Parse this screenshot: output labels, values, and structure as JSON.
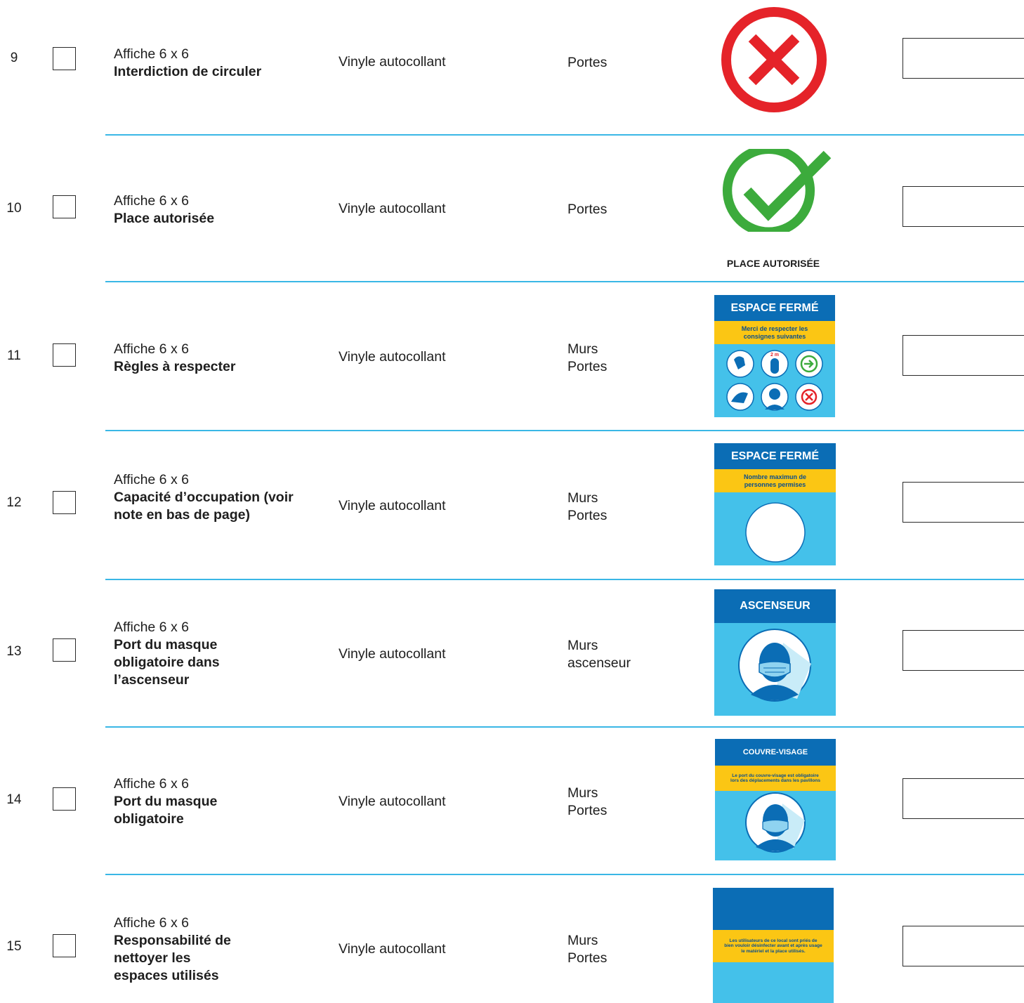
{
  "rows": [
    {
      "num": "9",
      "format": "Affiche 6 x 6",
      "name": "Interdiction de circuler",
      "material": "Vinyle autocollant",
      "locations": [
        "Portes"
      ],
      "qty": ""
    },
    {
      "num": "10",
      "format": "Affiche 6 x 6",
      "name": "Place autorisée",
      "material": "Vinyle autocollant",
      "locations": [
        "Portes"
      ],
      "qty": ""
    },
    {
      "num": "11",
      "format": "Affiche 6 x 6",
      "name": "Règles à respecter",
      "material": "Vinyle autocollant",
      "locations": [
        "Murs",
        "Portes"
      ],
      "qty": ""
    },
    {
      "num": "12",
      "format": "Affiche 6 x 6",
      "name": "Capacité d’occupation (voir note en bas de page)",
      "material": "Vinyle autocollant",
      "locations": [
        "Murs",
        "Portes"
      ],
      "qty": ""
    },
    {
      "num": "13",
      "format": "Affiche 6 x 6",
      "name": "Port du masque obligatoire dans l’ascenseur",
      "material": "Vinyle autocollant",
      "locations": [
        "Murs",
        "ascenseur"
      ],
      "qty": ""
    },
    {
      "num": "14",
      "format": "Affiche 6 x 6",
      "name": "Port du masque obligatoire",
      "material": "Vinyle autocollant",
      "locations": [
        "Murs",
        "Portes"
      ],
      "qty": ""
    },
    {
      "num": "15",
      "format": "Affiche 6 x 6",
      "name": "Responsabilité de nettoyer les espaces utilisés",
      "material": "Vinyle autocollant",
      "locations": [
        "Murs",
        "Portes"
      ],
      "qty": ""
    }
  ],
  "signs": {
    "place_caption": "PLACE AUTORISÉE",
    "rules_title": "ESPACE FERMÉ",
    "rules_band": "Merci de respecter les consignes suivantes",
    "rules_distance": "2 m",
    "capacity_title": "ESPACE FERMÉ",
    "capacity_band": "Nombre maximun de personnes permises",
    "elevator_title": "ASCENSEUR",
    "mask_title": "COUVRE-VISAGE",
    "mask_band": "Le port du couvre-visage est obligatoire lors des déplacements dans les pavillons",
    "clean_band": "Les utilisateurs de ce local sont priés de bien vouloir désinfecter avant et après usage le matériel et la place utilisés."
  },
  "colors": {
    "red": "#e52329",
    "green": "#3cab3c",
    "dark_blue": "#0b6db5",
    "light_blue": "#44c1ea",
    "yellow": "#fbc614",
    "separator": "#3ab7e6"
  }
}
